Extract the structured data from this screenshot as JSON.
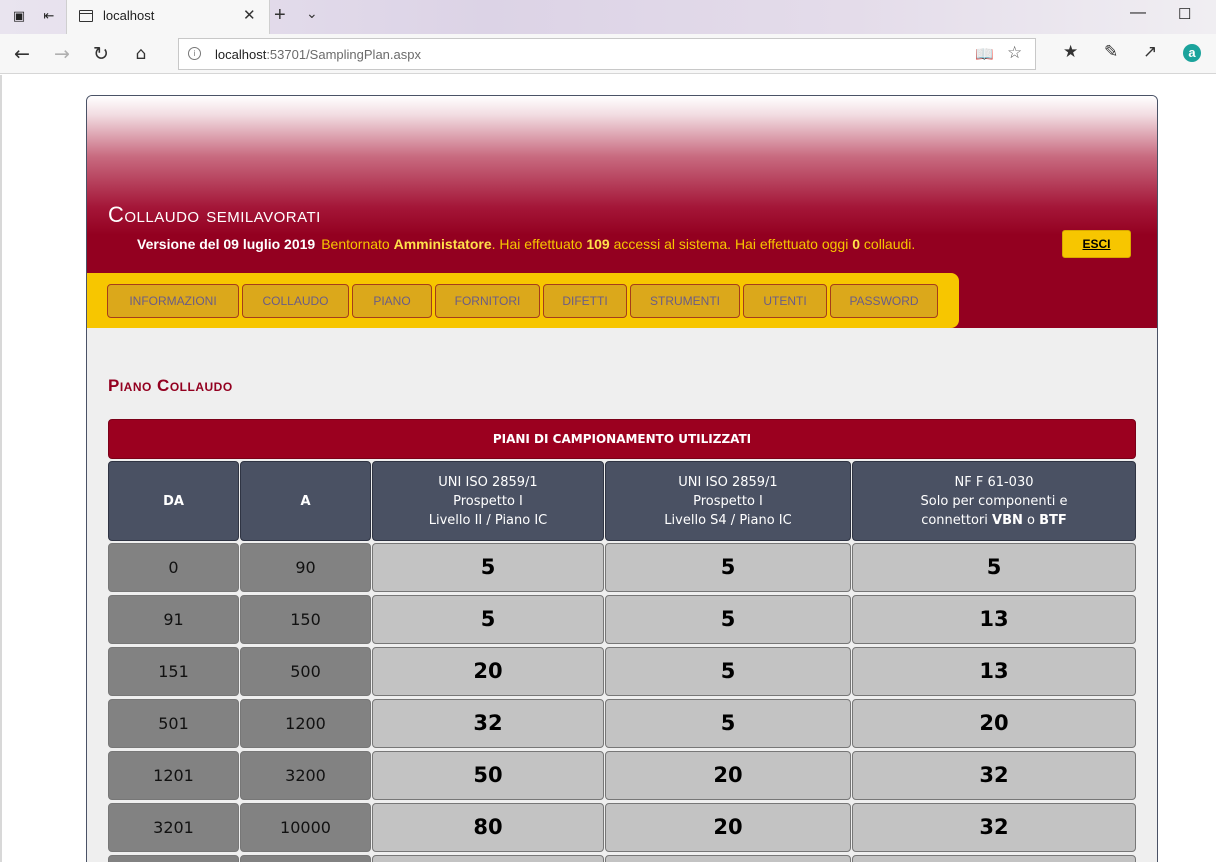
{
  "browser": {
    "tab_title": "localhost",
    "address_host": "localhost",
    "address_path": ":53701/SamplingPlan.aspx"
  },
  "header": {
    "site_title": "Collaudo semilavorati",
    "version": "Versione del 09 luglio 2019",
    "welcome_prefix": "Bentornato ",
    "user": "Amministatore",
    "welcome_mid": ". Hai effettuato ",
    "access_count": "109",
    "welcome_mid2": " accessi al sistema. Hai effettuato oggi ",
    "today_count": "0",
    "welcome_suffix": " collaudi.",
    "logout_label": "ESCI"
  },
  "menu": [
    {
      "label": "INFORMAZIONI"
    },
    {
      "label": "COLLAUDO"
    },
    {
      "label": "PIANO"
    },
    {
      "label": "FORNITORI"
    },
    {
      "label": "DIFETTI"
    },
    {
      "label": "STRUMENTI"
    },
    {
      "label": "UTENTI"
    },
    {
      "label": "PASSWORD"
    }
  ],
  "section_title": "Piano Collaudo",
  "table": {
    "caption": "PIANI DI CAMPIONAMENTO UTILIZZATI",
    "headers": {
      "da": "DA",
      "a": "A",
      "col1": [
        "UNI ISO 2859/1",
        "Prospetto I",
        "Livello II / Piano IC"
      ],
      "col2": [
        "UNI ISO 2859/1",
        "Prospetto I",
        "Livello S4 / Piano IC"
      ],
      "col3_line1": "NF F 61-030",
      "col3_line2": "Solo per componenti e",
      "col3_line3_pre": "connettori ",
      "col3_vbn": "VBN",
      "col3_mid": " o ",
      "col3_btf": "BTF"
    },
    "rows": [
      {
        "da": "0",
        "a": "90",
        "v1": "5",
        "v2": "5",
        "v3": "5"
      },
      {
        "da": "91",
        "a": "150",
        "v1": "5",
        "v2": "5",
        "v3": "13"
      },
      {
        "da": "151",
        "a": "500",
        "v1": "20",
        "v2": "5",
        "v3": "13"
      },
      {
        "da": "501",
        "a": "1200",
        "v1": "32",
        "v2": "5",
        "v3": "20"
      },
      {
        "da": "1201",
        "a": "3200",
        "v1": "50",
        "v2": "20",
        "v3": "32"
      },
      {
        "da": "3201",
        "a": "10000",
        "v1": "80",
        "v2": "20",
        "v3": "32"
      }
    ]
  }
}
